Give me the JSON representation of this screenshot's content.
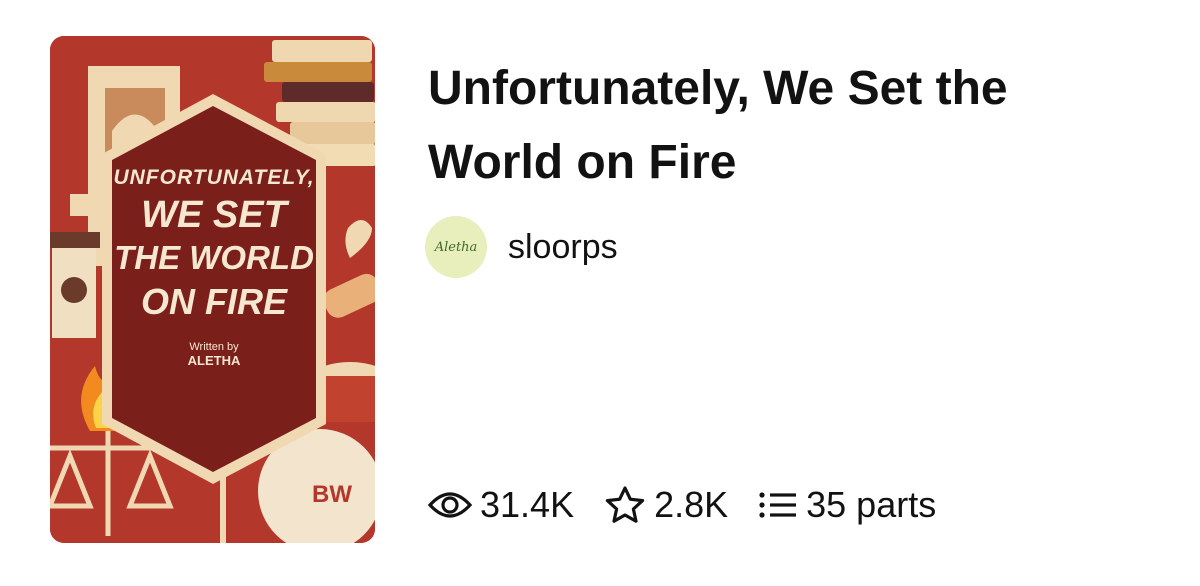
{
  "story": {
    "title": "Unfortunately, We Set the World on Fire",
    "author": "sloorps",
    "avatar_text": "Aletha"
  },
  "cover": {
    "lines": [
      "UNFORTUNATELY,",
      "WE SET",
      "THE WORLD",
      "ON FIRE"
    ],
    "written_by": "Written by",
    "pen_name": "ALETHA",
    "badge": "BW"
  },
  "stats": {
    "reads": "31.4K",
    "votes": "2.8K",
    "parts": "35 parts"
  },
  "icons": {
    "reads": "eye-icon",
    "votes": "star-icon",
    "parts": "list-icon"
  },
  "colors": {
    "cover_bg": "#b3372a",
    "cover_panel": "#7a1f1a",
    "avatar_bg": "#e8eebc"
  }
}
